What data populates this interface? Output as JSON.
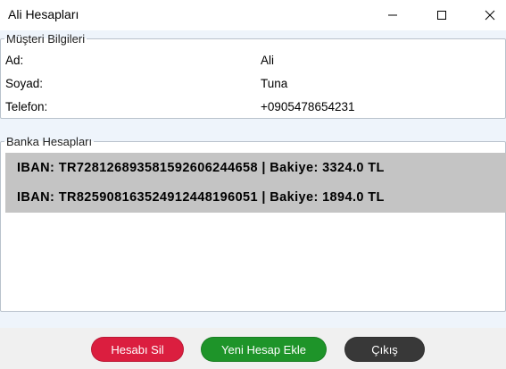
{
  "window": {
    "title": "Ali Hesapları"
  },
  "customer": {
    "legend": "Müşteri Bilgileri",
    "rows": [
      {
        "label": "Ad:",
        "value": "Ali"
      },
      {
        "label": "Soyad:",
        "value": "Tuna"
      },
      {
        "label": "Telefon:",
        "value": "+0905478654231"
      }
    ]
  },
  "bank": {
    "legend": "Banka Hesapları",
    "accounts": [
      "IBAN: TR728126893581592606244658 | Bakiye: 3324.0 TL",
      "IBAN: TR825908163524912448196051 | Bakiye: 1894.0 TL"
    ]
  },
  "buttons": {
    "delete": "Hesabı Sil",
    "add": "Yeni Hesap Ekle",
    "exit": "Çıkış"
  },
  "colors": {
    "delete": "#db1e3f",
    "add": "#1e9429",
    "exit": "#383838",
    "selection": "#c4c4c4"
  }
}
